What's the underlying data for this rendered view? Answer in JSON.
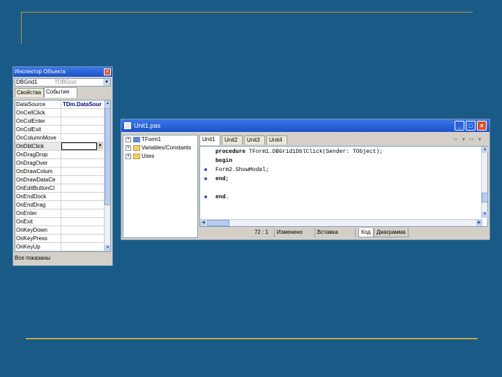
{
  "inspector": {
    "title": "Инспектор Объекта",
    "component_name": "DBGrid1",
    "component_class": "TDBGrid",
    "tabs": [
      "Свойства",
      "События"
    ],
    "active_tab": 1,
    "events": [
      {
        "key": "DataSource",
        "value": "TDm.DataSour"
      },
      {
        "key": "OnCellClick",
        "value": ""
      },
      {
        "key": "OnColEnter",
        "value": ""
      },
      {
        "key": "OnColExit",
        "value": ""
      },
      {
        "key": "OnColumnMove",
        "value": ""
      },
      {
        "key": "OnDblClick",
        "value": ""
      },
      {
        "key": "OnDragDrop",
        "value": ""
      },
      {
        "key": "OnDragOver",
        "value": ""
      },
      {
        "key": "OnDrawColum",
        "value": ""
      },
      {
        "key": "OnDrawDataCe",
        "value": ""
      },
      {
        "key": "OnEditButtonCl",
        "value": ""
      },
      {
        "key": "OnEndDock",
        "value": ""
      },
      {
        "key": "OnEndDrag",
        "value": ""
      },
      {
        "key": "OnEnter",
        "value": ""
      },
      {
        "key": "OnExit",
        "value": ""
      },
      {
        "key": "OnKeyDown",
        "value": ""
      },
      {
        "key": "OnKeyPress",
        "value": ""
      },
      {
        "key": "OnKeyUp",
        "value": ""
      }
    ],
    "status": "Все показаны"
  },
  "editor": {
    "title": "Unit1.pas",
    "tree": [
      {
        "label": "TForm1",
        "icon": "class-icon"
      },
      {
        "label": "Variables/Constants",
        "icon": "folder-icon"
      },
      {
        "label": "Uses",
        "icon": "folder-icon"
      }
    ],
    "tabs": [
      "Unit1",
      "Unit2",
      "Unit3",
      "Unit4"
    ],
    "nav": "⇦ ▾ ⇨ ▾",
    "code": {
      "line1_kw": "procedure",
      "line1_rest": " TForm1.DBGrid1DblClick(Sender: TObject);",
      "line2_kw": "begin",
      "line3": "Form2.ShowModal;",
      "line4_kw": "end;",
      "line5_kw": "end."
    },
    "status": {
      "position": "72 : 1",
      "modified": "Изменено",
      "mode": "Вставка",
      "tab_code": "Код",
      "tab_diagram": "Диаграмма"
    }
  }
}
